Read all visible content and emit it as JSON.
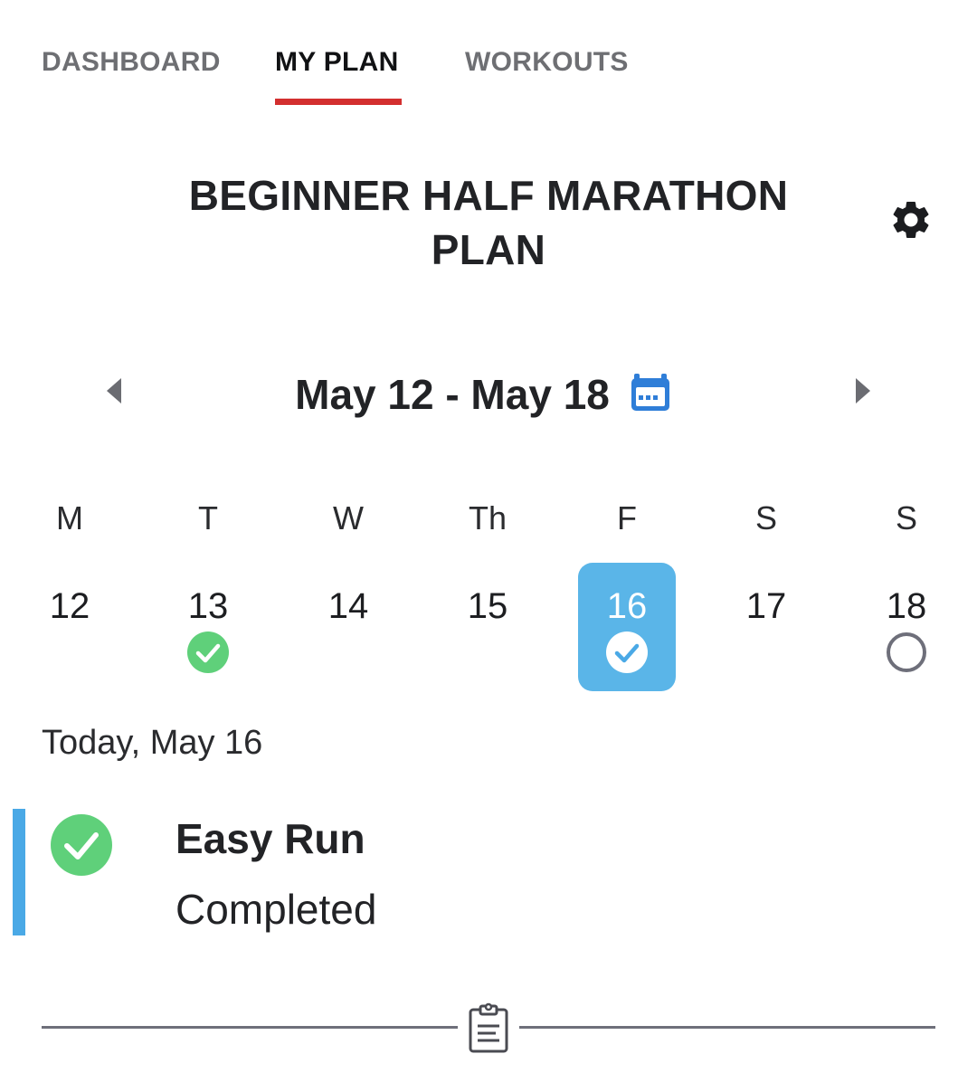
{
  "tabs": [
    {
      "label": "DASHBOARD",
      "active": false
    },
    {
      "label": "MY PLAN",
      "active": true
    },
    {
      "label": "WORKOUTS",
      "active": false
    }
  ],
  "plan": {
    "title": "BEGINNER HALF MARATHON PLAN",
    "settings_icon": "gear-icon"
  },
  "week": {
    "range": "May 12 - May 18",
    "prev_icon": "chevron-left-icon",
    "next_icon": "chevron-right-icon",
    "calendar_icon": "calendar-icon"
  },
  "days": [
    {
      "label": "M",
      "date": "12",
      "status": "none",
      "selected": false
    },
    {
      "label": "T",
      "date": "13",
      "status": "completed",
      "selected": false
    },
    {
      "label": "W",
      "date": "14",
      "status": "none",
      "selected": false
    },
    {
      "label": "Th",
      "date": "15",
      "status": "none",
      "selected": false
    },
    {
      "label": "F",
      "date": "16",
      "status": "completed",
      "selected": true
    },
    {
      "label": "S",
      "date": "17",
      "status": "none",
      "selected": false
    },
    {
      "label": "S",
      "date": "18",
      "status": "pending",
      "selected": false
    }
  ],
  "today": {
    "label": "Today, May 16",
    "workout": {
      "name": "Easy Run",
      "status": "Completed"
    }
  },
  "colors": {
    "accent_tab": "#d32f2f",
    "selected_day": "#5ab5e8",
    "completed": "#5fd07a",
    "calendar_icon": "#2f7ed8",
    "card_bar": "#4aa9e6"
  }
}
